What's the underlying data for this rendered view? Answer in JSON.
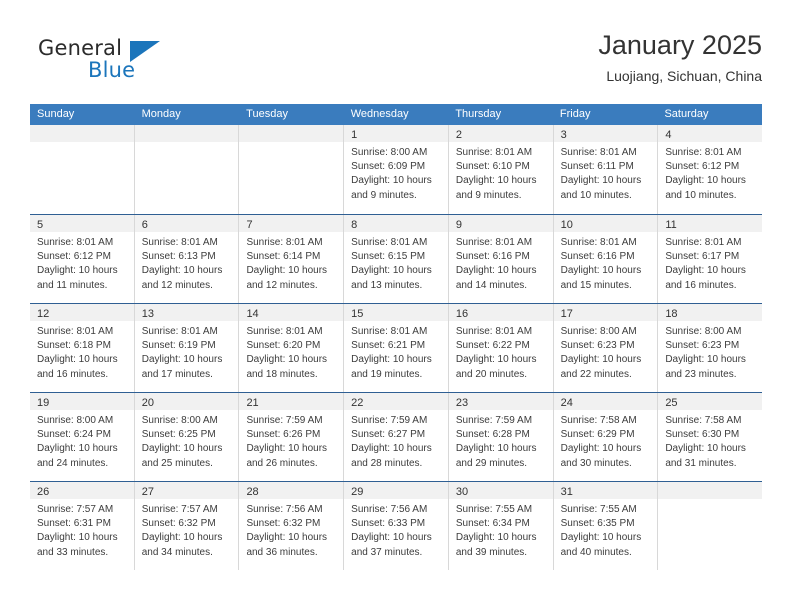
{
  "brand": {
    "line1": "General",
    "line2": "Blue",
    "triangle_color": "#1b75bb"
  },
  "header": {
    "title": "January 2025",
    "subtitle": "Luojiang, Sichuan, China"
  },
  "colors": {
    "header_blue": "#3a7cbe",
    "week_border": "#2f5f93",
    "day_band": "#f1f1f1",
    "cell_border": "#d8d8d8"
  },
  "weekdays": [
    "Sunday",
    "Monday",
    "Tuesday",
    "Wednesday",
    "Thursday",
    "Friday",
    "Saturday"
  ],
  "weeks": [
    [
      {
        "day": "",
        "empty": true
      },
      {
        "day": "",
        "empty": true
      },
      {
        "day": "",
        "empty": true
      },
      {
        "day": "1",
        "sunrise": "Sunrise: 8:00 AM",
        "sunset": "Sunset: 6:09 PM",
        "daylight": "Daylight: 10 hours and 9 minutes."
      },
      {
        "day": "2",
        "sunrise": "Sunrise: 8:01 AM",
        "sunset": "Sunset: 6:10 PM",
        "daylight": "Daylight: 10 hours and 9 minutes."
      },
      {
        "day": "3",
        "sunrise": "Sunrise: 8:01 AM",
        "sunset": "Sunset: 6:11 PM",
        "daylight": "Daylight: 10 hours and 10 minutes."
      },
      {
        "day": "4",
        "sunrise": "Sunrise: 8:01 AM",
        "sunset": "Sunset: 6:12 PM",
        "daylight": "Daylight: 10 hours and 10 minutes."
      }
    ],
    [
      {
        "day": "5",
        "sunrise": "Sunrise: 8:01 AM",
        "sunset": "Sunset: 6:12 PM",
        "daylight": "Daylight: 10 hours and 11 minutes."
      },
      {
        "day": "6",
        "sunrise": "Sunrise: 8:01 AM",
        "sunset": "Sunset: 6:13 PM",
        "daylight": "Daylight: 10 hours and 12 minutes."
      },
      {
        "day": "7",
        "sunrise": "Sunrise: 8:01 AM",
        "sunset": "Sunset: 6:14 PM",
        "daylight": "Daylight: 10 hours and 12 minutes."
      },
      {
        "day": "8",
        "sunrise": "Sunrise: 8:01 AM",
        "sunset": "Sunset: 6:15 PM",
        "daylight": "Daylight: 10 hours and 13 minutes."
      },
      {
        "day": "9",
        "sunrise": "Sunrise: 8:01 AM",
        "sunset": "Sunset: 6:16 PM",
        "daylight": "Daylight: 10 hours and 14 minutes."
      },
      {
        "day": "10",
        "sunrise": "Sunrise: 8:01 AM",
        "sunset": "Sunset: 6:16 PM",
        "daylight": "Daylight: 10 hours and 15 minutes."
      },
      {
        "day": "11",
        "sunrise": "Sunrise: 8:01 AM",
        "sunset": "Sunset: 6:17 PM",
        "daylight": "Daylight: 10 hours and 16 minutes."
      }
    ],
    [
      {
        "day": "12",
        "sunrise": "Sunrise: 8:01 AM",
        "sunset": "Sunset: 6:18 PM",
        "daylight": "Daylight: 10 hours and 16 minutes."
      },
      {
        "day": "13",
        "sunrise": "Sunrise: 8:01 AM",
        "sunset": "Sunset: 6:19 PM",
        "daylight": "Daylight: 10 hours and 17 minutes."
      },
      {
        "day": "14",
        "sunrise": "Sunrise: 8:01 AM",
        "sunset": "Sunset: 6:20 PM",
        "daylight": "Daylight: 10 hours and 18 minutes."
      },
      {
        "day": "15",
        "sunrise": "Sunrise: 8:01 AM",
        "sunset": "Sunset: 6:21 PM",
        "daylight": "Daylight: 10 hours and 19 minutes."
      },
      {
        "day": "16",
        "sunrise": "Sunrise: 8:01 AM",
        "sunset": "Sunset: 6:22 PM",
        "daylight": "Daylight: 10 hours and 20 minutes."
      },
      {
        "day": "17",
        "sunrise": "Sunrise: 8:00 AM",
        "sunset": "Sunset: 6:23 PM",
        "daylight": "Daylight: 10 hours and 22 minutes."
      },
      {
        "day": "18",
        "sunrise": "Sunrise: 8:00 AM",
        "sunset": "Sunset: 6:23 PM",
        "daylight": "Daylight: 10 hours and 23 minutes."
      }
    ],
    [
      {
        "day": "19",
        "sunrise": "Sunrise: 8:00 AM",
        "sunset": "Sunset: 6:24 PM",
        "daylight": "Daylight: 10 hours and 24 minutes."
      },
      {
        "day": "20",
        "sunrise": "Sunrise: 8:00 AM",
        "sunset": "Sunset: 6:25 PM",
        "daylight": "Daylight: 10 hours and 25 minutes."
      },
      {
        "day": "21",
        "sunrise": "Sunrise: 7:59 AM",
        "sunset": "Sunset: 6:26 PM",
        "daylight": "Daylight: 10 hours and 26 minutes."
      },
      {
        "day": "22",
        "sunrise": "Sunrise: 7:59 AM",
        "sunset": "Sunset: 6:27 PM",
        "daylight": "Daylight: 10 hours and 28 minutes."
      },
      {
        "day": "23",
        "sunrise": "Sunrise: 7:59 AM",
        "sunset": "Sunset: 6:28 PM",
        "daylight": "Daylight: 10 hours and 29 minutes."
      },
      {
        "day": "24",
        "sunrise": "Sunrise: 7:58 AM",
        "sunset": "Sunset: 6:29 PM",
        "daylight": "Daylight: 10 hours and 30 minutes."
      },
      {
        "day": "25",
        "sunrise": "Sunrise: 7:58 AM",
        "sunset": "Sunset: 6:30 PM",
        "daylight": "Daylight: 10 hours and 31 minutes."
      }
    ],
    [
      {
        "day": "26",
        "sunrise": "Sunrise: 7:57 AM",
        "sunset": "Sunset: 6:31 PM",
        "daylight": "Daylight: 10 hours and 33 minutes."
      },
      {
        "day": "27",
        "sunrise": "Sunrise: 7:57 AM",
        "sunset": "Sunset: 6:32 PM",
        "daylight": "Daylight: 10 hours and 34 minutes."
      },
      {
        "day": "28",
        "sunrise": "Sunrise: 7:56 AM",
        "sunset": "Sunset: 6:32 PM",
        "daylight": "Daylight: 10 hours and 36 minutes."
      },
      {
        "day": "29",
        "sunrise": "Sunrise: 7:56 AM",
        "sunset": "Sunset: 6:33 PM",
        "daylight": "Daylight: 10 hours and 37 minutes."
      },
      {
        "day": "30",
        "sunrise": "Sunrise: 7:55 AM",
        "sunset": "Sunset: 6:34 PM",
        "daylight": "Daylight: 10 hours and 39 minutes."
      },
      {
        "day": "31",
        "sunrise": "Sunrise: 7:55 AM",
        "sunset": "Sunset: 6:35 PM",
        "daylight": "Daylight: 10 hours and 40 minutes."
      },
      {
        "day": "",
        "empty": true
      }
    ]
  ]
}
